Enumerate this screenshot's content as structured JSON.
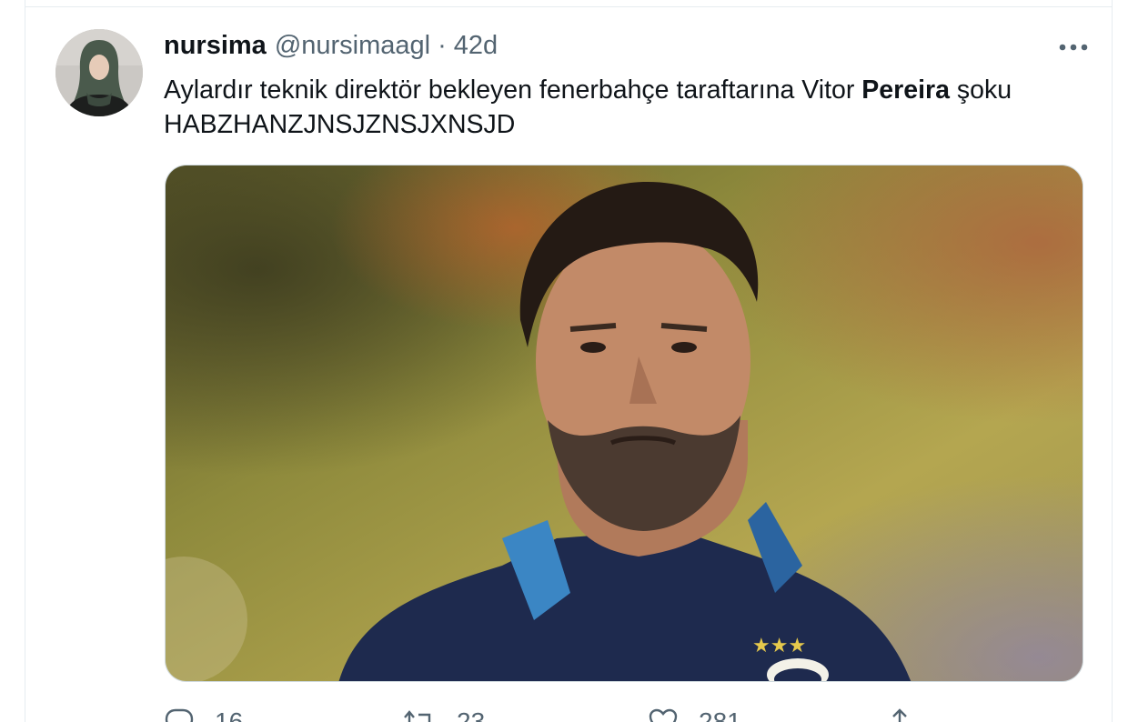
{
  "tweet": {
    "display_name": "nursima",
    "handle": "@nursimaagl",
    "separator": "·",
    "time": "42d",
    "text_before": "Aylardır teknik direktör bekleyen fenerbahçe taraftarına Vitor ",
    "text_bold": "Pereira",
    "text_after": " şoku HABZHANZJNSJZNSJXNSJD",
    "media_description": "photo"
  },
  "actions": {
    "reply_count": "16",
    "retweet_count": "23",
    "like_count": "281"
  },
  "icons": {
    "more": "more-horizontal-icon",
    "reply": "reply-icon",
    "retweet": "retweet-icon",
    "like": "heart-icon",
    "share": "share-icon"
  },
  "colors": {
    "text": "#0f1419",
    "secondary": "#536471",
    "border": "#e6ecf0"
  }
}
